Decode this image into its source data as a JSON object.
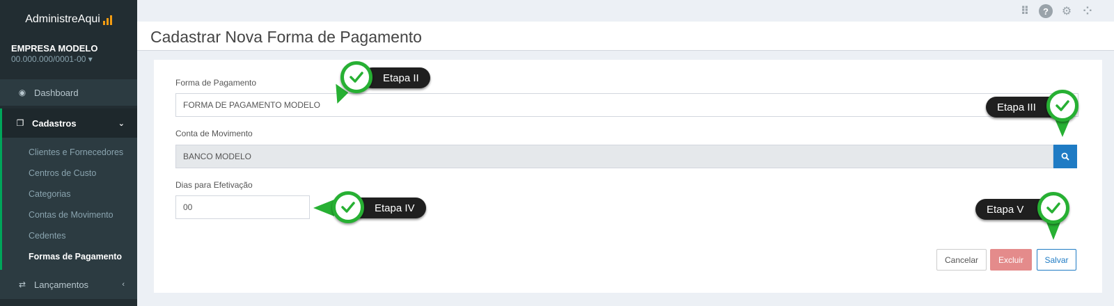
{
  "app": {
    "brand": "AdministreAqui",
    "company_name": "EMPRESA MODELO",
    "company_cnpj": "00.000.000/0001-00 ▾"
  },
  "sidebar": {
    "dashboard": "Dashboard",
    "cadastros": "Cadastros",
    "subitems": [
      "Clientes e Fornecedores",
      "Centros de Custo",
      "Categorias",
      "Contas de Movimento",
      "Cedentes",
      "Formas de Pagamento"
    ],
    "lancamentos": "Lançamentos"
  },
  "page": {
    "title": "Cadastrar Nova Forma de Pagamento"
  },
  "form": {
    "forma_label": "Forma de Pagamento",
    "forma_value": "FORMA DE PAGAMENTO MODELO",
    "conta_label": "Conta de Movimento",
    "conta_value": "BANCO MODELO",
    "dias_label": "Dias para Efetivação",
    "dias_value": "00"
  },
  "buttons": {
    "cancel": "Cancelar",
    "delete": "Excluir",
    "save": "Salvar"
  },
  "steps": {
    "s2": "Etapa II",
    "s3": "Etapa III",
    "s4": "Etapa IV",
    "s5": "Etapa V"
  },
  "colors": {
    "accent": "#1f7bc4",
    "check_green": "#27b033",
    "sidebar_bg": "#222d32"
  }
}
